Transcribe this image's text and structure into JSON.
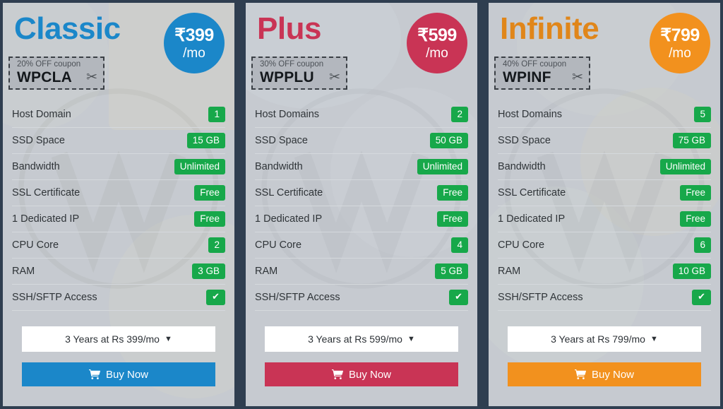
{
  "page": {
    "background_color": "#2f3e50",
    "card_background_color": "#c6cad0",
    "badge_color": "#17a84a"
  },
  "plans": [
    {
      "name": "Classic",
      "accent_color": "#1b87c9",
      "price_amount": "₹399",
      "price_period": "/mo",
      "coupon_off": "20% OFF coupon",
      "coupon_code": "WPCLA",
      "scissors_icon": "✂",
      "features": [
        {
          "label": "Host Domain",
          "value": "1"
        },
        {
          "label": "SSD Space",
          "value": "15 GB"
        },
        {
          "label": "Bandwidth",
          "value": "Unlimited"
        },
        {
          "label": "SSL Certificate",
          "value": "Free"
        },
        {
          "label": "1 Dedicated IP",
          "value": "Free"
        },
        {
          "label": "CPU Core",
          "value": "2"
        },
        {
          "label": "RAM",
          "value": "3 GB"
        },
        {
          "label": "SSH/SFTP Access",
          "value": "✔"
        }
      ],
      "term_label": "3 Years at Rs 399/mo",
      "term_caret": "▼",
      "buy_label": "Buy Now"
    },
    {
      "name": "Plus",
      "accent_color": "#c93455",
      "price_amount": "₹599",
      "price_period": "/mo",
      "coupon_off": "30% OFF coupon",
      "coupon_code": "WPPLU",
      "scissors_icon": "✂",
      "features": [
        {
          "label": "Host Domains",
          "value": "2"
        },
        {
          "label": "SSD Space",
          "value": "50 GB"
        },
        {
          "label": "Bandwidth",
          "value": "Unlimited"
        },
        {
          "label": "SSL Certificate",
          "value": "Free"
        },
        {
          "label": "1 Dedicated IP",
          "value": "Free"
        },
        {
          "label": "CPU Core",
          "value": "4"
        },
        {
          "label": "RAM",
          "value": "5 GB"
        },
        {
          "label": "SSH/SFTP Access",
          "value": "✔"
        }
      ],
      "term_label": "3 Years at Rs 599/mo",
      "term_caret": "▼",
      "buy_label": "Buy Now"
    },
    {
      "name": "Infinite",
      "accent_color": "#f2911e",
      "price_amount": "₹799",
      "price_period": "/mo",
      "coupon_off": "40% OFF coupon",
      "coupon_code": "WPINF",
      "scissors_icon": "✂",
      "features": [
        {
          "label": "Host Domains",
          "value": "5"
        },
        {
          "label": "SSD Space",
          "value": "75 GB"
        },
        {
          "label": "Bandwidth",
          "value": "Unlimited"
        },
        {
          "label": "SSL Certificate",
          "value": "Free"
        },
        {
          "label": "1 Dedicated IP",
          "value": "Free"
        },
        {
          "label": "CPU Core",
          "value": "6"
        },
        {
          "label": "RAM",
          "value": "10 GB"
        },
        {
          "label": "SSH/SFTP Access",
          "value": "✔"
        }
      ],
      "term_label": "3 Years at Rs 799/mo",
      "term_caret": "▼",
      "buy_label": "Buy Now"
    }
  ]
}
